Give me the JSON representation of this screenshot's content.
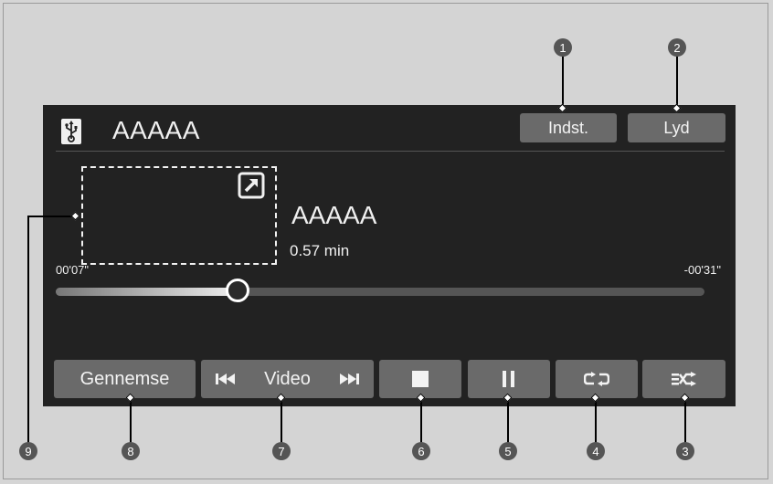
{
  "header": {
    "title": "AAAAA",
    "source_icon": "usb-icon",
    "settings_label": "Indst.",
    "sound_label": "Lyd"
  },
  "media": {
    "track_title": "AAAAA",
    "track_duration": "0.57 min",
    "elapsed": "00'07\"",
    "remaining": "-00'31\"",
    "progress_fraction": 0.28
  },
  "controls": {
    "browse_label": "Gennemse",
    "video_label": "Video",
    "prev_icon": "skip-previous-icon",
    "next_icon": "skip-next-icon",
    "stop_icon": "stop-icon",
    "pause_icon": "pause-icon",
    "repeat_icon": "repeat-icon",
    "shuffle_icon": "shuffle-icon"
  },
  "callouts": {
    "n1": "1",
    "n2": "2",
    "n3": "3",
    "n4": "4",
    "n5": "5",
    "n6": "6",
    "n7": "7",
    "n8": "8",
    "n9": "9"
  },
  "colors": {
    "screen_bg": "#222222",
    "button_bg": "#6a6a6a",
    "badge_bg": "#555555"
  }
}
